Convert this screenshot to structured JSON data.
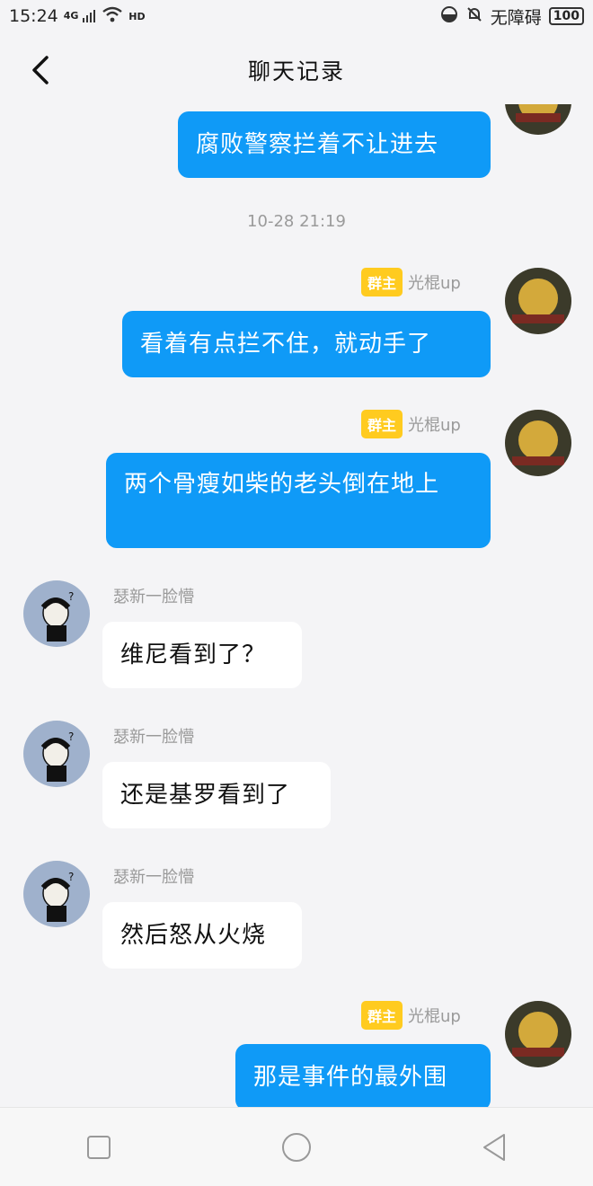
{
  "status_bar": {
    "time": "15:24",
    "network": "4G",
    "hd": "HD",
    "mode": "无障碍",
    "battery": "100"
  },
  "header": {
    "title": "聊天记录"
  },
  "messages": [
    {
      "text": "腐败警察拦着不让进去"
    },
    {
      "timestamp": "10-28 21:19"
    },
    {
      "badge": "群主",
      "sender": "光棍up",
      "text": "看着有点拦不住，就动手了"
    },
    {
      "badge": "群主",
      "sender": "光棍up",
      "text": "两个骨瘦如柴的老头倒在地上"
    },
    {
      "sender": "瑟新一脸懵",
      "text": "维尼看到了？"
    },
    {
      "sender": "瑟新一脸懵",
      "text": "还是基罗看到了"
    },
    {
      "sender": "瑟新一脸懵",
      "text": "然后怒从火烧"
    },
    {
      "badge": "群主",
      "sender": "光棍up",
      "text": "那是事件的最外围"
    }
  ],
  "colors": {
    "my_bubble": "#0f9af7",
    "badge": "#ffcb1f",
    "page_bg": "#f4f4f6"
  }
}
